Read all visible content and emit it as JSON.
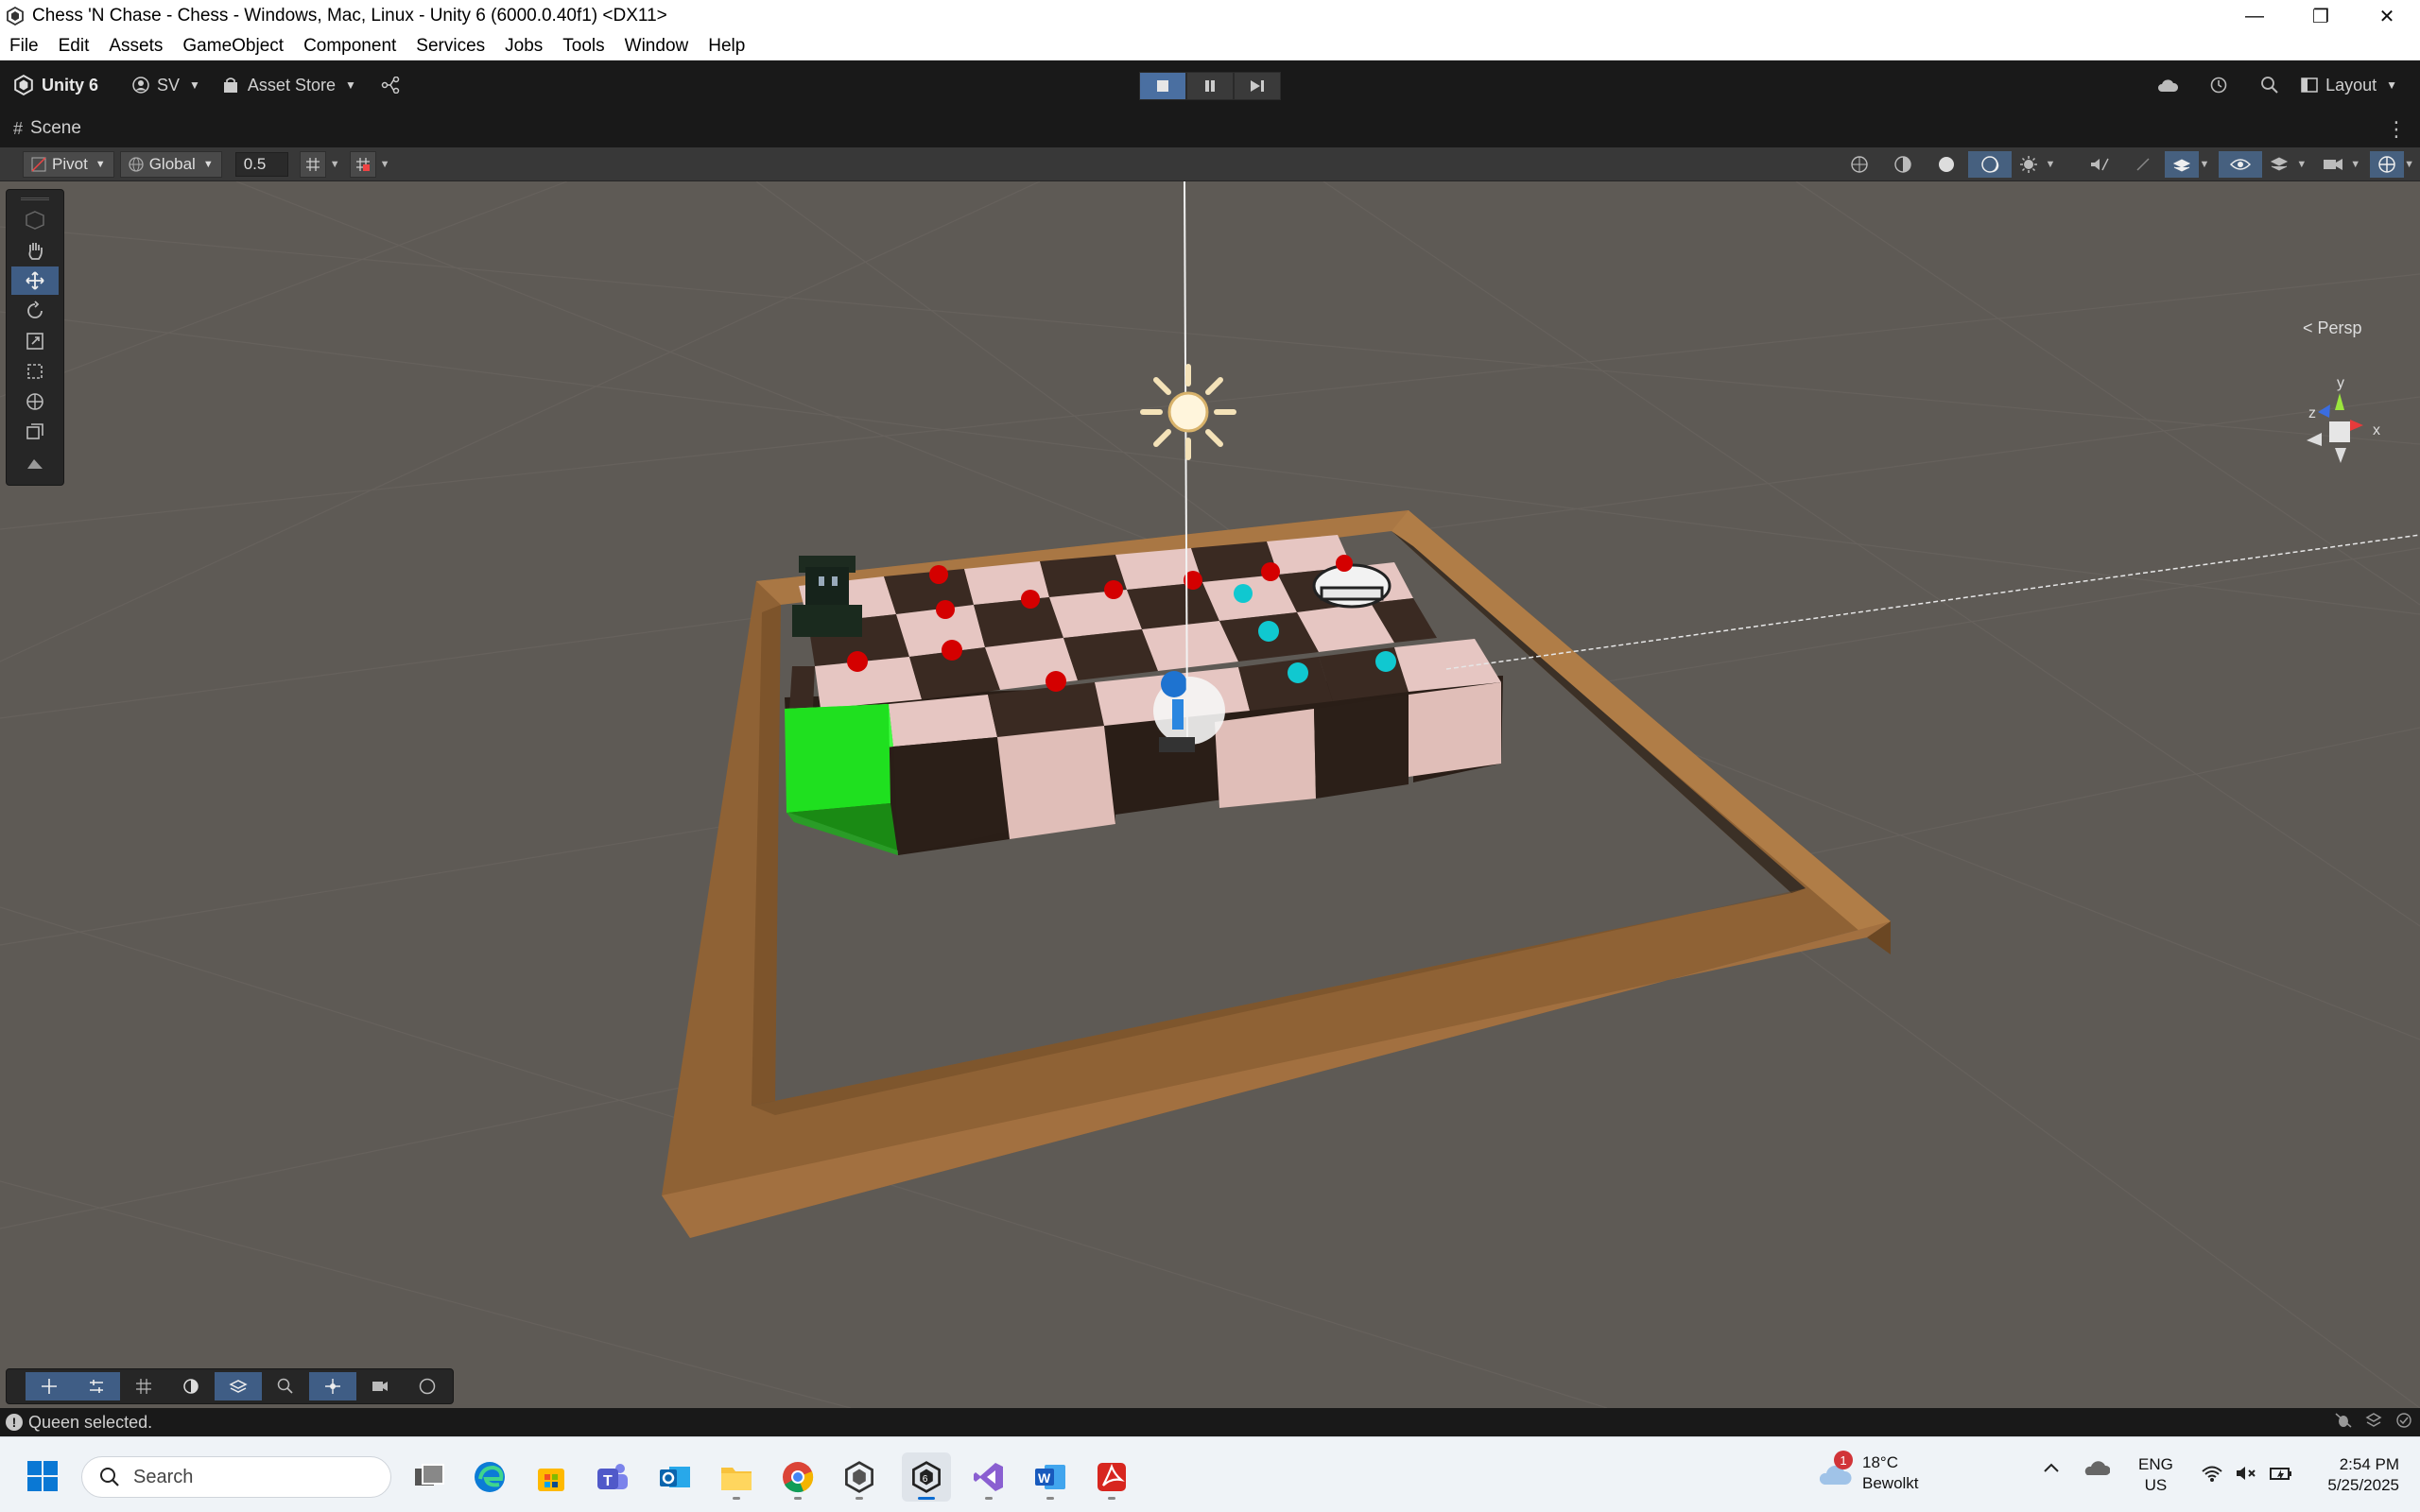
{
  "window": {
    "title": "Chess 'N Chase - Chess - Windows, Mac, Linux - Unity 6 (6000.0.40f1) <DX11>",
    "minimize": "—",
    "restore": "❐",
    "close": "✕"
  },
  "menu": [
    "File",
    "Edit",
    "Assets",
    "GameObject",
    "Component",
    "Services",
    "Jobs",
    "Tools",
    "Window",
    "Help"
  ],
  "toolbar": {
    "unity_label": "Unity 6",
    "account_label": "SV",
    "asset_store_label": "Asset Store",
    "layout_label": "Layout",
    "play_state": "playing"
  },
  "scene_tab": {
    "label": "Scene"
  },
  "scene_toolbar": {
    "pivot_label": "Pivot",
    "global_label": "Global",
    "snap_value": "0.5"
  },
  "scene_view": {
    "camera_mode": "< Persp",
    "gizmo_axes": [
      "y",
      "z",
      "x"
    ]
  },
  "status": {
    "message": "Queen selected."
  },
  "taskbar": {
    "search_placeholder": "Search",
    "apps": [
      "task-view",
      "edge",
      "store",
      "teams",
      "outlook",
      "file-explorer",
      "chrome",
      "unity-hub",
      "unity-editor",
      "visual-studio",
      "word",
      "acrobat"
    ],
    "active_app": "unity-editor",
    "weather_temp": "18°C",
    "weather_desc": "Bewolkt",
    "weather_badge": "1",
    "lang_primary": "ENG",
    "lang_secondary": "US",
    "time": "2:54 PM",
    "date": "5/25/2025"
  },
  "colors": {
    "viewport_bg": "#5e5a55",
    "board_light": "#e6c6c2",
    "board_dark": "#3a2a22",
    "frame": "#9a6a3a",
    "highlight_tile": "#22ff22",
    "red_marker": "#d40000",
    "cyan_marker": "#10c8d0"
  }
}
